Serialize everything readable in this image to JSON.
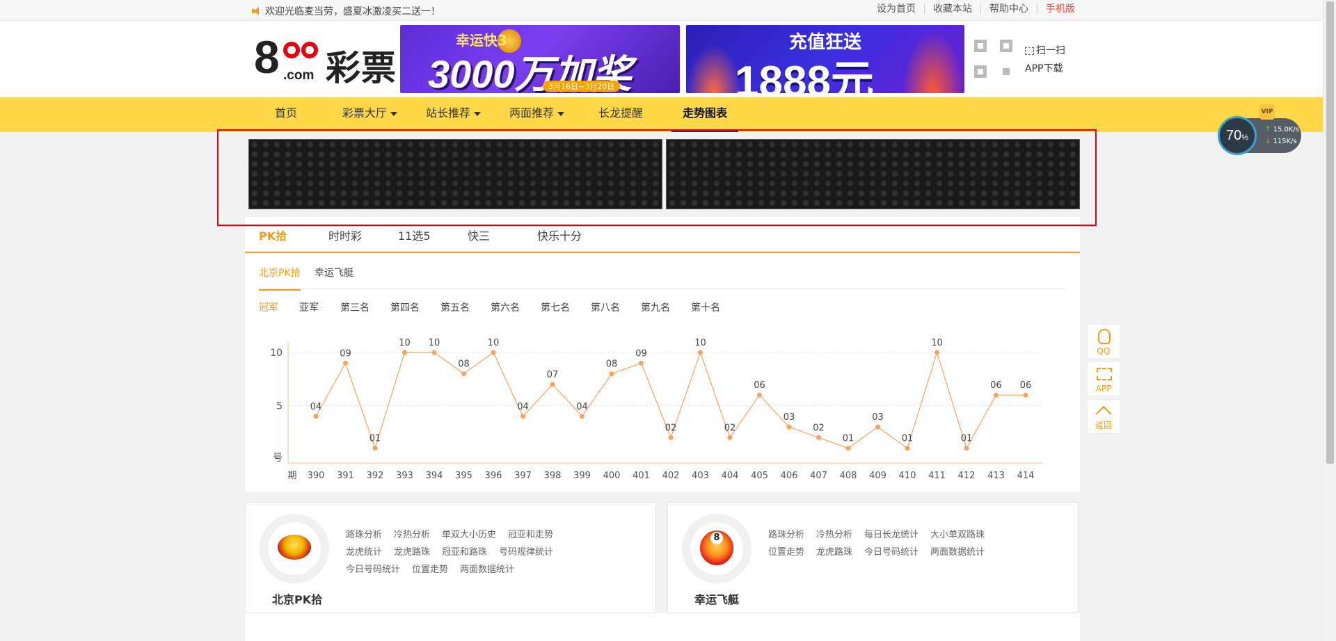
{
  "topbar": {
    "welcome": "欢迎光临麦当劳，盛夏冰激凌买二送一！",
    "links": [
      "设为首页",
      "收藏本站",
      "帮助中心",
      "手机版"
    ]
  },
  "header": {
    "logo_number": "8",
    "logo_com": ".com",
    "logo_text": "彩票",
    "banner1": {
      "title": "幸运快3",
      "main": "3000万加奖",
      "sub": "3月16日~3月20日"
    },
    "banner2": {
      "title": "充值狂送",
      "main": "1888元"
    },
    "scan": "扫一扫",
    "app_download": "APP下载"
  },
  "nav": {
    "items": [
      {
        "label": "首页",
        "dropdown": false
      },
      {
        "label": "彩票大厅",
        "dropdown": true
      },
      {
        "label": "站长推荐",
        "dropdown": true
      },
      {
        "label": "两面推荐",
        "dropdown": true
      },
      {
        "label": "长龙提醒",
        "dropdown": false
      },
      {
        "label": "走势图表",
        "dropdown": false,
        "active": true
      }
    ]
  },
  "lottery_tabs": [
    "PK拾",
    "时时彩",
    "11选5",
    "快三",
    "快乐十分"
  ],
  "sub_tabs": [
    "北京PK拾",
    "幸运飞艇"
  ],
  "position_tabs": [
    "冠军",
    "亚军",
    "第三名",
    "第四名",
    "第五名",
    "第六名",
    "第七名",
    "第八名",
    "第九名",
    "第十名"
  ],
  "chart_data": {
    "type": "line",
    "xlabel": "期",
    "ylabel": "号",
    "ylim": [
      0,
      10
    ],
    "yticks": [
      "10",
      "5"
    ],
    "x": [
      "390",
      "391",
      "392",
      "393",
      "394",
      "395",
      "396",
      "397",
      "398",
      "399",
      "400",
      "401",
      "402",
      "403",
      "404",
      "405",
      "406",
      "407",
      "408",
      "409",
      "410",
      "411",
      "412",
      "413",
      "414"
    ],
    "values": [
      4,
      9,
      1,
      10,
      10,
      8,
      10,
      4,
      7,
      4,
      8,
      9,
      2,
      10,
      2,
      6,
      3,
      2,
      1,
      3,
      1,
      10,
      1,
      6,
      6
    ],
    "labels": [
      "04",
      "09",
      "01",
      "10",
      "10",
      "08",
      "10",
      "04",
      "07",
      "04",
      "08",
      "09",
      "02",
      "10",
      "02",
      "06",
      "03",
      "02",
      "01",
      "03",
      "01",
      "10",
      "01",
      "06",
      "06"
    ],
    "color": "#f7a35c"
  },
  "cards": [
    {
      "title": "北京PK拾",
      "links": [
        "路珠分析",
        "冷热分析",
        "单双大小历史",
        "冠亚和走势",
        "龙虎统计",
        "龙虎路珠",
        "冠亚和路珠",
        "号码规律统计",
        "今日号码统计",
        "位置走势",
        "两面数据统计"
      ]
    },
    {
      "title": "幸运飞艇",
      "links": [
        "路珠分析",
        "冷热分析",
        "每日长龙统计",
        "大小单双路珠",
        "位置走势",
        "龙虎路珠",
        "今日号码统计",
        "两面数据统计"
      ]
    }
  ],
  "float": {
    "qq": "QQ",
    "app": "APP",
    "back": "返回"
  },
  "speed": {
    "percent": "70",
    "unit": "%",
    "up": "15.0K/s",
    "down": "115K/s",
    "vip": "VIP"
  },
  "colors": {
    "accent": "#f39c12",
    "nav_bg": "#ffd84a",
    "brand_red": "#e60012"
  }
}
